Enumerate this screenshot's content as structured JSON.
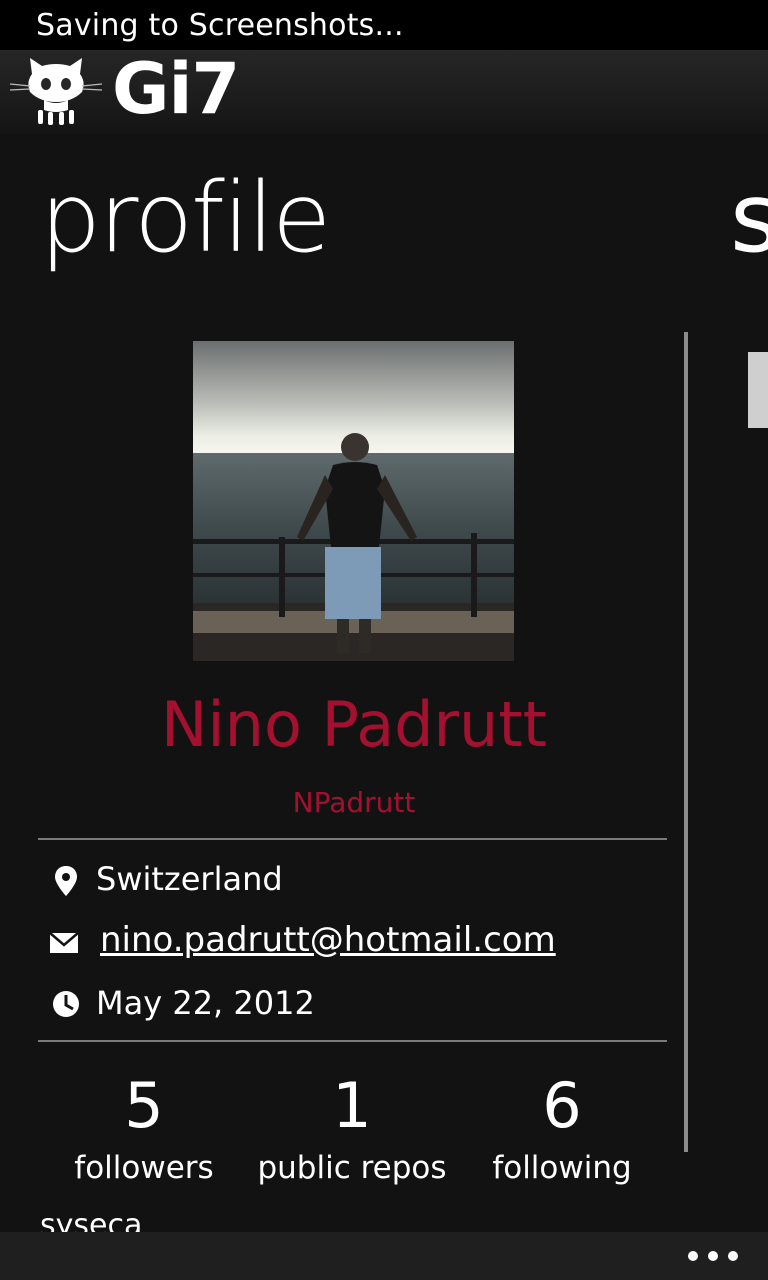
{
  "status_bar": {
    "text": "Saving to Screenshots..."
  },
  "app": {
    "title": "Gi7",
    "logo_icon": "octocat-icon"
  },
  "pivot": {
    "current": "profile",
    "next_peek": "s"
  },
  "profile": {
    "avatar_icon": "profile-photo",
    "full_name": "Nino Padrutt",
    "username": "NPadrutt",
    "location": "Switzerland",
    "email": "nino.padrutt@hotmail.com",
    "joined": "May 22, 2012",
    "accent_color": "#a4102f"
  },
  "stats": [
    {
      "value": "5",
      "label": "followers"
    },
    {
      "value": "1",
      "label": "public repos"
    },
    {
      "value": "6",
      "label": "following"
    }
  ],
  "partial_item": "syseca",
  "app_bar": {
    "more_icon": "ellipsis-icon"
  }
}
